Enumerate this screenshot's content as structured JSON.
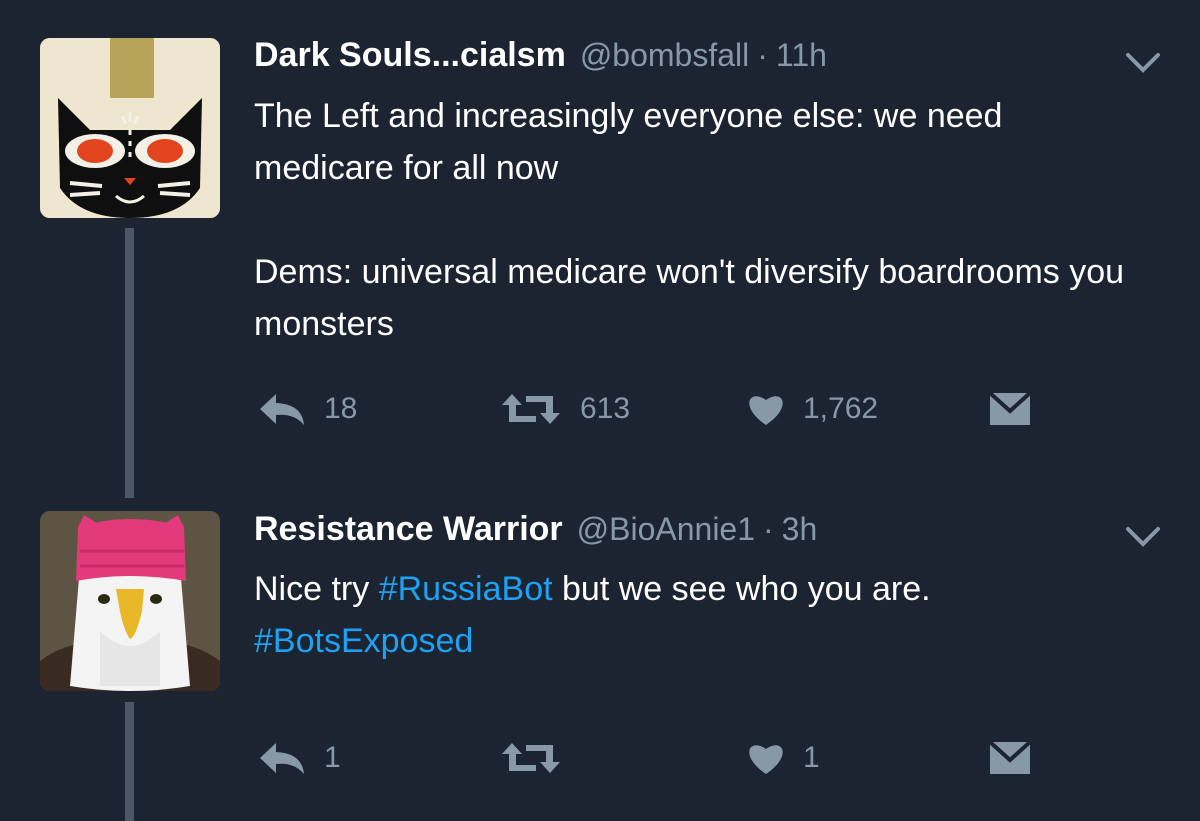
{
  "tweets": [
    {
      "author_name": "Dark Souls...cialsm",
      "handle": "@bombsfall",
      "separator": "·",
      "time": "11h",
      "body": [
        "The Left and increasingly everyone else: we need medicare for all now",
        "Dems: universal medicare won't diversify boardrooms you monsters"
      ],
      "reply_count": "18",
      "retweet_count": "613",
      "like_count": "1,762"
    },
    {
      "author_name": "Resistance Warrior",
      "handle": "@BioAnnie1",
      "separator": "·",
      "time": "3h",
      "body_prefix": "Nice try ",
      "hashtag_1": "#RussiaBot",
      "body_middle": " but we see who you are. ",
      "hashtag_2": "#BotsExposed",
      "reply_count": "1",
      "retweet_count": "",
      "like_count": "1"
    }
  ],
  "colors": {
    "background": "#1b2430",
    "text": "#ffffff",
    "muted": "#8899a6",
    "hashtag": "#1da1f2",
    "thread_line": "#4a5866"
  },
  "icons": [
    "chevron-down-icon",
    "reply-icon",
    "retweet-icon",
    "heart-icon",
    "direct-message-icon"
  ]
}
